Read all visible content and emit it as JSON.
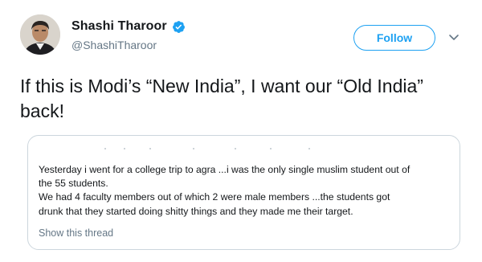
{
  "user": {
    "display_name": "Shashi Tharoor",
    "handle": "@ShashiTharoor",
    "verified": true,
    "avatar": "profile-photo"
  },
  "actions": {
    "follow_label": "Follow",
    "more_icon": "chevron-down-icon"
  },
  "tweet": {
    "text": "If this is Modi’s “New India”, I want our “Old India” back!"
  },
  "quoted_tweet": {
    "lines": [
      "Yesterday i went for a college trip to agra ...i was the only single muslim student out of",
      "the 55 students.",
      "We had 4 faculty members out of which 2 were male members ...the students got",
      "drunk that they started doing shitty things and they made me their target."
    ],
    "show_thread_label": "Show this thread"
  },
  "colors": {
    "accent": "#1da1f2",
    "secondary_text": "#657786",
    "border": "#ccd6dd"
  }
}
